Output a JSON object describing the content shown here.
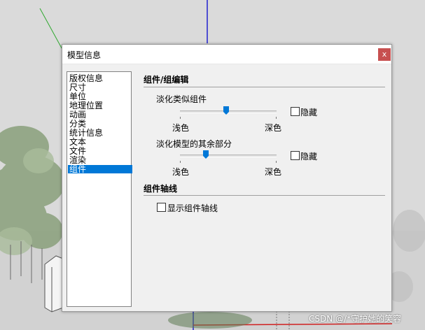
{
  "dialog": {
    "title": "模型信息",
    "close_label": "x"
  },
  "categories": [
    {
      "label": "版权信息",
      "selected": false
    },
    {
      "label": "尺寸",
      "selected": false
    },
    {
      "label": "单位",
      "selected": false
    },
    {
      "label": "地理位置",
      "selected": false
    },
    {
      "label": "动画",
      "selected": false
    },
    {
      "label": "分类",
      "selected": false
    },
    {
      "label": "统计信息",
      "selected": false
    },
    {
      "label": "文本",
      "selected": false
    },
    {
      "label": "文件",
      "selected": false
    },
    {
      "label": "渲染",
      "selected": false
    },
    {
      "label": "组件",
      "selected": true
    }
  ],
  "component_edit": {
    "heading": "组件/组编辑",
    "fade_similar": {
      "label": "淡化类似组件",
      "slider_value_fraction": 0.48,
      "min_label": "浅色",
      "max_label": "深色",
      "hide_label": "隐藏",
      "hide_checked": false
    },
    "fade_rest": {
      "label": "淡化模型的其余部分",
      "slider_value_fraction": 0.25,
      "min_label": "浅色",
      "max_label": "深色",
      "hide_label": "隐藏",
      "hide_checked": false
    }
  },
  "component_axes": {
    "heading": "组件轴线",
    "show_axes_label": "显示组件轴线",
    "show_axes_checked": false
  },
  "watermark": "CSDN @/*守护她的笑容",
  "colors": {
    "selection": "#0078d7",
    "close_button": "#c75050",
    "slider_thumb": "#0078d7"
  }
}
